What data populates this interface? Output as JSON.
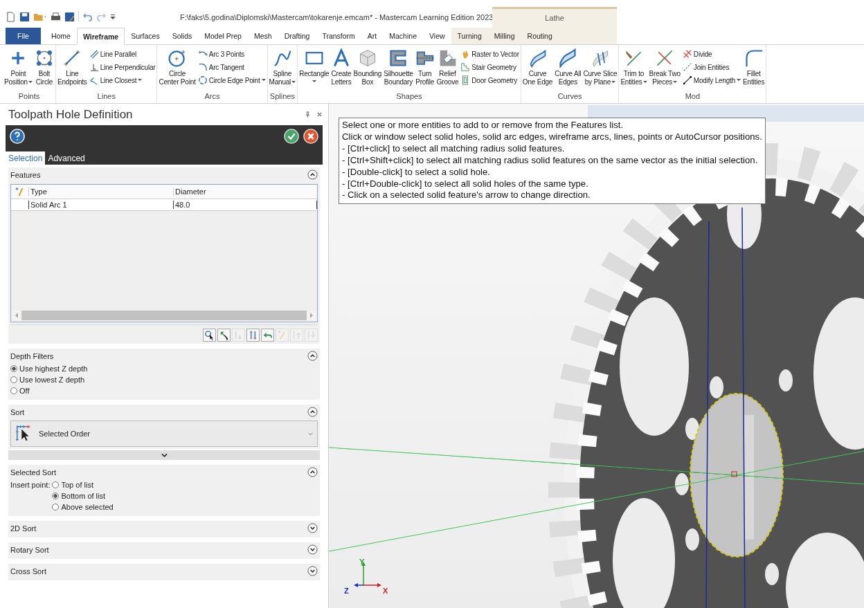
{
  "title_bar": {
    "title": "F:\\faks\\5.godina\\Diplomski\\Mastercam\\tokarenje.emcam* - Mastercam Learning Edition 2023",
    "context_group": "Lathe"
  },
  "tabs": [
    {
      "label": "File",
      "kind": "file",
      "selected": false
    },
    {
      "label": "Home",
      "kind": "main",
      "selected": false
    },
    {
      "label": "Wireframe",
      "kind": "main",
      "selected": true
    },
    {
      "label": "Surfaces",
      "kind": "main",
      "selected": false
    },
    {
      "label": "Solids",
      "kind": "main",
      "selected": false
    },
    {
      "label": "Model Prep",
      "kind": "main",
      "selected": false
    },
    {
      "label": "Mesh",
      "kind": "main",
      "selected": false
    },
    {
      "label": "Drafting",
      "kind": "main",
      "selected": false
    },
    {
      "label": "Transform",
      "kind": "main",
      "selected": false
    },
    {
      "label": "Art",
      "kind": "main",
      "selected": false
    },
    {
      "label": "Machine",
      "kind": "main",
      "selected": false
    },
    {
      "label": "View",
      "kind": "main",
      "selected": false
    },
    {
      "label": "Turning",
      "kind": "context",
      "selected": false
    },
    {
      "label": "Milling",
      "kind": "context",
      "selected": false
    },
    {
      "label": "Routing",
      "kind": "context",
      "selected": false
    }
  ],
  "ribbon": {
    "groups": [
      {
        "label": "Points",
        "items": [
          {
            "kind": "large",
            "lines": [
              "Point",
              "Position"
            ],
            "dropdown": true
          },
          {
            "kind": "large",
            "lines": [
              "Bolt",
              "Circle"
            ],
            "dropdown": false
          }
        ]
      },
      {
        "label": "Lines",
        "items": [
          {
            "kind": "large",
            "lines": [
              "Line",
              "Endpoints"
            ],
            "dropdown": false
          },
          {
            "kind": "stack",
            "items": [
              {
                "label": "Line Parallel",
                "dropdown": false
              },
              {
                "label": "Line Perpendicular",
                "dropdown": false
              },
              {
                "label": "Line Closest",
                "dropdown": true
              }
            ]
          }
        ]
      },
      {
        "label": "Arcs",
        "items": [
          {
            "kind": "large",
            "lines": [
              "Circle",
              "Center Point"
            ],
            "dropdown": false
          },
          {
            "kind": "stack",
            "items": [
              {
                "label": "Arc 3 Points",
                "dropdown": false
              },
              {
                "label": "Arc Tangent",
                "dropdown": false
              },
              {
                "label": "Circle Edge Point",
                "dropdown": true
              }
            ]
          }
        ]
      },
      {
        "label": "Splines",
        "items": [
          {
            "kind": "large",
            "lines": [
              "Spline",
              "Manual"
            ],
            "dropdown": true
          }
        ]
      },
      {
        "label": "Shapes",
        "items": [
          {
            "kind": "large",
            "lines": [
              "Rectangle"
            ],
            "dropdown": true
          },
          {
            "kind": "large",
            "lines": [
              "Create",
              "Letters"
            ],
            "dropdown": false
          },
          {
            "kind": "large",
            "lines": [
              "Bounding",
              "Box"
            ],
            "dropdown": false
          },
          {
            "kind": "large",
            "lines": [
              "Silhouette",
              "Boundary"
            ],
            "dropdown": false
          },
          {
            "kind": "large",
            "lines": [
              "Turn",
              "Profile"
            ],
            "dropdown": false
          },
          {
            "kind": "large",
            "lines": [
              "Relief",
              "Groove"
            ],
            "dropdown": false
          },
          {
            "kind": "stack",
            "items": [
              {
                "label": "Raster to Vector",
                "dropdown": false
              },
              {
                "label": "Stair Geometry",
                "dropdown": false
              },
              {
                "label": "Door Geometry",
                "dropdown": false
              }
            ]
          }
        ]
      },
      {
        "label": "Curves",
        "items": [
          {
            "kind": "large",
            "lines": [
              "Curve",
              "One Edge"
            ],
            "dropdown": false
          },
          {
            "kind": "large",
            "lines": [
              "Curve All",
              "Edges"
            ],
            "dropdown": false
          },
          {
            "kind": "large",
            "lines": [
              "Curve Slice",
              "by Plane"
            ],
            "dropdown": true
          }
        ]
      },
      {
        "label": "Mod",
        "items": [
          {
            "kind": "large",
            "lines": [
              "Trim to",
              "Entities"
            ],
            "dropdown": true
          },
          {
            "kind": "large",
            "lines": [
              "Break Two",
              "Pieces"
            ],
            "dropdown": true
          },
          {
            "kind": "stack",
            "items": [
              {
                "label": "Divide",
                "dropdown": false
              },
              {
                "label": "Join Entities",
                "dropdown": false
              },
              {
                "label": "Modify Length",
                "dropdown": true
              }
            ]
          },
          {
            "kind": "large",
            "lines": [
              "Fillet",
              "Entities"
            ],
            "dropdown": false
          }
        ]
      }
    ]
  },
  "panel": {
    "title": "Toolpath Hole Definition",
    "tabs": [
      {
        "label": "Selection",
        "selected": true
      },
      {
        "label": "Advanced",
        "selected": false
      }
    ],
    "sections": [
      {
        "kind": "features",
        "title": "Features",
        "expanded": true,
        "columns": [
          "Type",
          "Diameter"
        ],
        "rows": [
          {
            "type": "Solid Arc 1",
            "diameter": "48.0"
          }
        ],
        "tools": [
          {
            "disabled": false
          },
          {
            "disabled": false
          },
          {
            "disabled": true
          },
          {
            "disabled": false
          },
          {
            "disabled": false
          },
          {
            "disabled": true
          },
          {
            "disabled": true
          },
          {
            "disabled": true
          }
        ]
      },
      {
        "kind": "radios",
        "title": "Depth Filters",
        "expanded": true,
        "options": [
          {
            "label": "Use highest Z depth",
            "selected": true
          },
          {
            "label": "Use lowest Z depth",
            "selected": false
          },
          {
            "label": "Off",
            "selected": false
          }
        ]
      },
      {
        "kind": "dropdown",
        "title": "Sort",
        "expanded": true,
        "value": "Selected Order"
      },
      {
        "kind": "insert",
        "title": "Selected Sort",
        "expanded": true,
        "label": "Insert point:",
        "options": [
          {
            "label": "Top of list",
            "selected": false
          },
          {
            "label": "Bottom of list",
            "selected": true
          },
          {
            "label": "Above selected",
            "selected": false
          }
        ]
      },
      {
        "kind": "plain",
        "title": "2D Sort",
        "expanded": false
      },
      {
        "kind": "plain",
        "title": "Rotary Sort",
        "expanded": false
      },
      {
        "kind": "plain",
        "title": "Cross Sort",
        "expanded": false
      }
    ]
  },
  "viewport": {
    "tooltip": [
      "Select one or more entities to add to or remove from the Features list.",
      "Click or window select solid holes, solid arc edges, wireframe arcs, lines, points or AutoCursor positions.",
      "- [Ctrl+click] to select all matching radius solid features.",
      "- [Ctrl+Shift+click] to select all matching radius solid features on the same vector as the initial selection.",
      "- [Double-click] to select a solid hole.",
      "- [Ctrl+Double-click] to select all solid holes of the same type.",
      "- Click on a selected solid feature's arrow to change direction."
    ],
    "axes": {
      "x": "X",
      "y": "Y",
      "z": "Z"
    }
  }
}
